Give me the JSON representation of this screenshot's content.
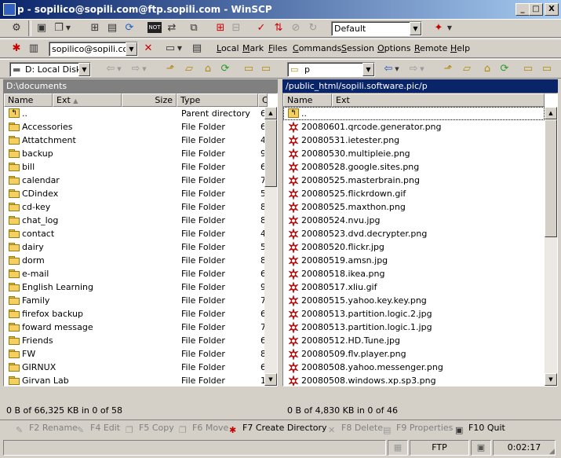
{
  "window": {
    "title": "p - sopilico@sopili.com@ftp.sopili.com - WinSCP",
    "minimize": "_",
    "maximize": "□",
    "close": "X"
  },
  "toolbar1": {
    "profile_value": "Default"
  },
  "toolbar2": {
    "session_value": "sopilico@sopili.com",
    "menu": [
      "Local",
      "Mark",
      "Files",
      "Commands",
      "Session",
      "Options",
      "Remote",
      "Help"
    ]
  },
  "left": {
    "drive_value": "D: Local Disk",
    "path": "D:\\documents",
    "columns": [
      "Name",
      "Ext",
      "Size",
      "Type",
      "C"
    ],
    "rows": [
      {
        "name": "..",
        "type": "Parent directory",
        "c": "6"
      },
      {
        "name": "Accessories",
        "type": "File Folder",
        "c": "6"
      },
      {
        "name": "Attatchment",
        "type": "File Folder",
        "c": "4"
      },
      {
        "name": "backup",
        "type": "File Folder",
        "c": "9"
      },
      {
        "name": "bill",
        "type": "File Folder",
        "c": "6"
      },
      {
        "name": "calendar",
        "type": "File Folder",
        "c": "7"
      },
      {
        "name": "CDindex",
        "type": "File Folder",
        "c": "5"
      },
      {
        "name": "cd-key",
        "type": "File Folder",
        "c": "8"
      },
      {
        "name": "chat_log",
        "type": "File Folder",
        "c": "8"
      },
      {
        "name": "contact",
        "type": "File Folder",
        "c": "4"
      },
      {
        "name": "dairy",
        "type": "File Folder",
        "c": "5"
      },
      {
        "name": "dorm",
        "type": "File Folder",
        "c": "8"
      },
      {
        "name": "e-mail",
        "type": "File Folder",
        "c": "6"
      },
      {
        "name": "English Learning",
        "type": "File Folder",
        "c": "9"
      },
      {
        "name": "Family",
        "type": "File Folder",
        "c": "7"
      },
      {
        "name": "firefox backup",
        "type": "File Folder",
        "c": "6"
      },
      {
        "name": "foward message",
        "type": "File Folder",
        "c": "7"
      },
      {
        "name": "Friends",
        "type": "File Folder",
        "c": "6"
      },
      {
        "name": "FW",
        "type": "File Folder",
        "c": "8"
      },
      {
        "name": "GIRNUX",
        "type": "File Folder",
        "c": "6"
      },
      {
        "name": "Girvan Lab",
        "type": "File Folder",
        "c": "1"
      }
    ],
    "status": "0 B of 66,325 KB in 0 of 58"
  },
  "right": {
    "folder_value": "p",
    "path": "/public_html/sopili.software.pic/p",
    "columns": [
      "Name",
      "Ext"
    ],
    "rows": [
      "..",
      "20080601.qrcode.generator.png",
      "20080531.ietester.png",
      "20080530.multipleie.png",
      "20080528.google.sites.png",
      "20080525.masterbrain.png",
      "20080525.flickrdown.gif",
      "20080525.maxthon.png",
      "20080524.nvu.jpg",
      "20080523.dvd.decrypter.png",
      "20080520.flickr.jpg",
      "20080519.amsn.jpg",
      "20080518.ikea.png",
      "20080517.xliu.gif",
      "20080515.yahoo.key.key.png",
      "20080513.partition.logic.2.jpg",
      "20080513.partition.logic.1.jpg",
      "20080512.HD.Tune.jpg",
      "20080509.flv.player.png",
      "20080508.yahoo.messenger.png",
      "20080508.windows.xp.sp3.png"
    ],
    "status": "0 B of 4,830 KB in 0 of 46"
  },
  "fkeys": [
    {
      "label": "F2 Rename",
      "enabled": false
    },
    {
      "label": "F4 Edit",
      "enabled": false
    },
    {
      "label": "F5 Copy",
      "enabled": false
    },
    {
      "label": "F6 Move",
      "enabled": false
    },
    {
      "label": "F7 Create Directory",
      "enabled": true
    },
    {
      "label": "F8 Delete",
      "enabled": false
    },
    {
      "label": "F9 Properties",
      "enabled": false
    },
    {
      "label": "F10 Quit",
      "enabled": true
    }
  ],
  "statusbar": {
    "protocol": "FTP",
    "time": "0:02:17"
  },
  "colors": {
    "titlebar_start": "#0a246a",
    "titlebar_end": "#a6caf0",
    "active_path": "#0a246a",
    "inactive_path": "#808080",
    "selection": "#0a246a"
  }
}
